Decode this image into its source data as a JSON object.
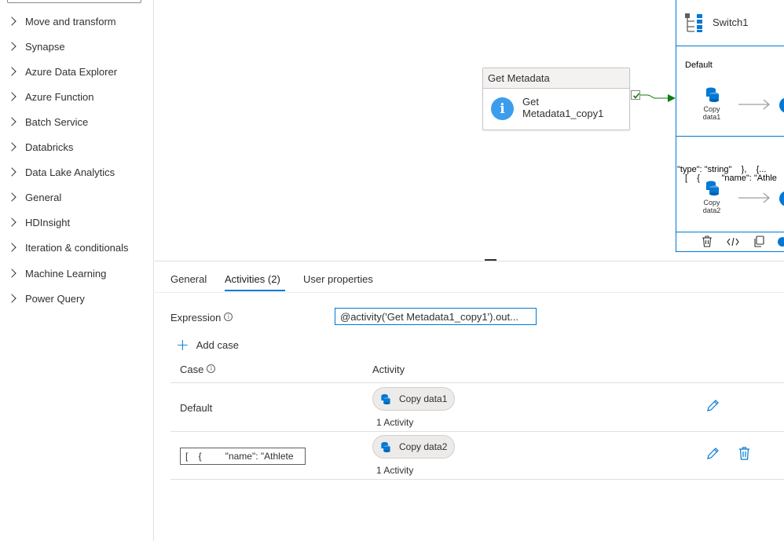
{
  "sidebar": {
    "categories": [
      "Move and transform",
      "Synapse",
      "Azure Data Explorer",
      "Azure Function",
      "Batch Service",
      "Databricks",
      "Data Lake Analytics",
      "General",
      "HDInsight",
      "Iteration & conditionals",
      "Machine Learning",
      "Power Query"
    ]
  },
  "canvas": {
    "get_metadata": {
      "header": "Get Metadata",
      "name_line1": "Get",
      "name_line2": "Metadata1_copy1"
    },
    "switch": {
      "title": "Switch1",
      "default_label": "Default",
      "default_activity_line1": "Copy",
      "default_activity_line2": "data1",
      "case_label_line1": "[    {         \"name\": \"Athle",
      "case_label_line2": "\"type\": \"string\"    },    {...",
      "case_activity_line1": "Copy",
      "case_activity_line2": "data2"
    }
  },
  "panel": {
    "tabs": {
      "general": "General",
      "activities": "Activities (2)",
      "user_properties": "User properties"
    },
    "expression_label": "Expression",
    "expression_value": "@activity('Get Metadata1_copy1').out...",
    "info_glyph": "i",
    "add_case": "Add case",
    "columns": {
      "case": "Case",
      "activity": "Activity"
    },
    "rows": [
      {
        "case": "Default",
        "activity": "Copy data1",
        "count": "1 Activity"
      },
      {
        "case": "[    {         \"name\": \"Athlete",
        "activity": "Copy data2",
        "count": "1 Activity"
      }
    ]
  },
  "colors": {
    "accent": "#0078d4",
    "info": "#3c9ded",
    "success": "#107c10"
  }
}
